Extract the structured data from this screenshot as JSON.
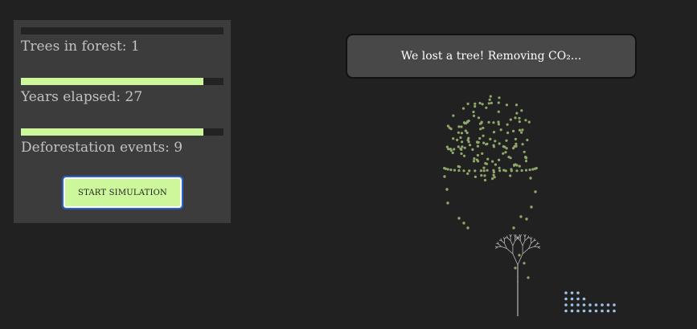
{
  "stats": [
    {
      "label": "Trees in forest: 1",
      "bar_level": 0
    },
    {
      "label": "Years elapsed: 27",
      "bar_level": 0.9
    },
    {
      "label": "Deforestation events: 9",
      "bar_level": 0.9
    }
  ],
  "start_button_label": "START SIMULATION",
  "toast_message": "We lost a tree! Removing CO₂...",
  "colors": {
    "background": "#212121",
    "panel": "#3c3c3c",
    "accent": "#ccf79a",
    "leaf_particles": "#8fa86a",
    "co2_dots": "#9fc3e6",
    "tree_lines": "#b8b8b8"
  },
  "icons": [
    "tree-icon",
    "leaf-particles",
    "co2-dots"
  ]
}
